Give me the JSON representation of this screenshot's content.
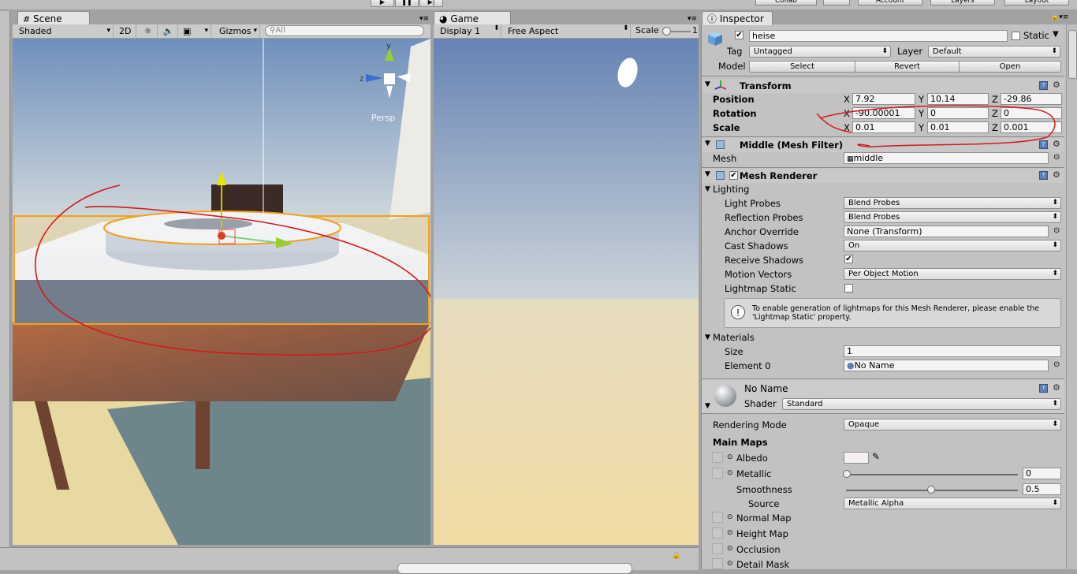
{
  "top_bar": {
    "collab": "Collab",
    "account": "Account",
    "layers": "Layers",
    "layout": "Layout"
  },
  "scene": {
    "tab_label": "Scene",
    "shading": "Shaded",
    "mode_2d": "2D",
    "gizmos": "Gizmos",
    "search_placeholder": "All",
    "gizmo_y": "y",
    "gizmo_z": "z",
    "persp": "Persp"
  },
  "game": {
    "tab_label": "Game",
    "display": "Display 1",
    "aspect": "Free Aspect",
    "scale_label": "Scale",
    "scale_value": "1"
  },
  "inspector": {
    "tab_label": "Inspector",
    "object_name": "heise",
    "static_label": "Static",
    "tag_label": "Tag",
    "tag_value": "Untagged",
    "layer_label": "Layer",
    "layer_value": "Default",
    "model_label": "Model",
    "select_btn": "Select",
    "revert_btn": "Revert",
    "open_btn": "Open",
    "transform": {
      "title": "Transform",
      "position_label": "Position",
      "rotation_label": "Rotation",
      "scale_label": "Scale",
      "axis_x": "X",
      "axis_y": "Y",
      "axis_z": "Z",
      "position": {
        "x": "7.92",
        "y": "10.14",
        "z": "-29.86"
      },
      "rotation": {
        "x": "-90.00001",
        "y": "0",
        "z": "0"
      },
      "scale": {
        "x": "0.01",
        "y": "0.01",
        "z": "0.001"
      }
    },
    "mesh_filter": {
      "title": "Middle (Mesh Filter)",
      "mesh_label": "Mesh",
      "mesh_value": "middle"
    },
    "mesh_renderer": {
      "title": "Mesh Renderer",
      "lighting_label": "Lighting",
      "light_probes_label": "Light Probes",
      "light_probes_value": "Blend Probes",
      "reflection_probes_label": "Reflection Probes",
      "reflection_probes_value": "Blend Probes",
      "anchor_override_label": "Anchor Override",
      "anchor_override_value": "None (Transform)",
      "cast_shadows_label": "Cast Shadows",
      "cast_shadows_value": "On",
      "receive_shadows_label": "Receive Shadows",
      "motion_vectors_label": "Motion Vectors",
      "motion_vectors_value": "Per Object Motion",
      "lightmap_static_label": "Lightmap Static",
      "info_text": "To enable generation of lightmaps for this Mesh Renderer, please enable the 'Lightmap Static' property.",
      "materials_label": "Materials",
      "size_label": "Size",
      "size_value": "1",
      "element0_label": "Element 0",
      "element0_value": "No Name"
    },
    "material": {
      "name": "No Name",
      "shader_label": "Shader",
      "shader_value": "Standard",
      "rendering_mode_label": "Rendering Mode",
      "rendering_mode_value": "Opaque",
      "main_maps_label": "Main Maps",
      "albedo_label": "Albedo",
      "metallic_label": "Metallic",
      "metallic_value": "0",
      "smoothness_label": "Smoothness",
      "smoothness_value": "0.5",
      "source_label": "Source",
      "source_value": "Metallic Alpha",
      "normal_map_label": "Normal Map",
      "height_map_label": "Height Map",
      "occlusion_label": "Occlusion",
      "detail_mask_label": "Detail Mask"
    }
  }
}
